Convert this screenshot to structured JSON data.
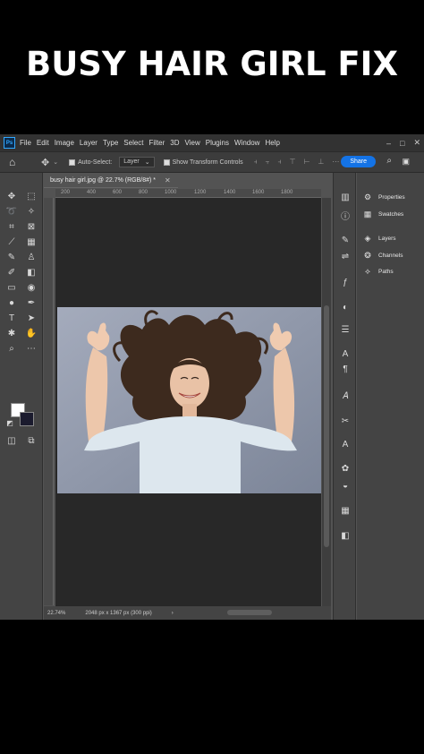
{
  "banner": {
    "title": "BUSY HAIR GIRL FIX"
  },
  "app": {
    "logo": "Ps",
    "menu": [
      "File",
      "Edit",
      "Image",
      "Layer",
      "Type",
      "Select",
      "Filter",
      "3D",
      "View",
      "Plugins",
      "Window",
      "Help"
    ],
    "window_controls": [
      "–",
      "□",
      "✕"
    ]
  },
  "options_bar": {
    "home_icon": "home-icon",
    "auto_select_label": "Auto-Select:",
    "layer_value": "Layer",
    "show_transform_label": "Show Transform Controls",
    "share_label": "Share"
  },
  "document": {
    "tab_title": "busy hair girl.jpg @ 22.7% (RGB/8#) *",
    "ruler_marks": [
      "200",
      "400",
      "600",
      "800",
      "1000",
      "1200",
      "1400",
      "1600",
      "1800"
    ]
  },
  "status_bar": {
    "zoom": "22.74%",
    "doc_info": "2048 px x 1367 px (300 ppi)",
    "chevron": "›"
  },
  "panels": {
    "items": [
      {
        "label": "Properties",
        "icon": "properties-icon"
      },
      {
        "label": "Swatches",
        "icon": "swatches-icon"
      },
      {
        "label": "Layers",
        "icon": "layers-icon"
      },
      {
        "label": "Channels",
        "icon": "channels-icon"
      },
      {
        "label": "Paths",
        "icon": "paths-icon"
      }
    ]
  },
  "colors": {
    "foreground": "#ffffff",
    "background": "#1b1b2e",
    "accent": "#1473e6"
  }
}
